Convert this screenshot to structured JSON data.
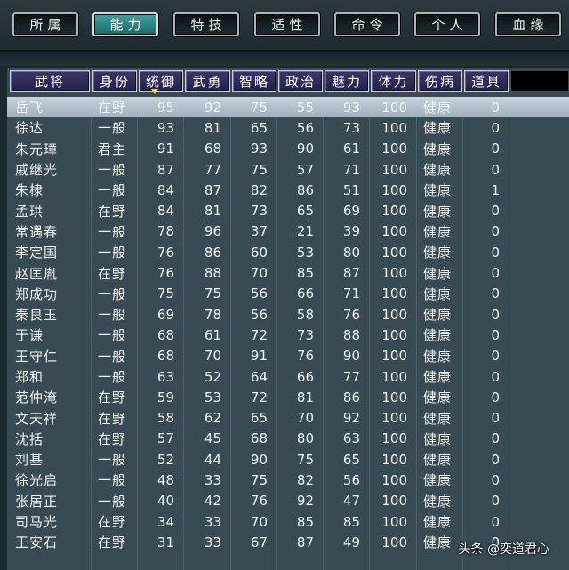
{
  "tabs": [
    {
      "label": "所属",
      "active": false
    },
    {
      "label": "能力",
      "active": true
    },
    {
      "label": "特技",
      "active": false
    },
    {
      "label": "适性",
      "active": false
    },
    {
      "label": "命令",
      "active": false
    },
    {
      "label": "个人",
      "active": false
    },
    {
      "label": "血缘",
      "active": false
    }
  ],
  "columns": [
    "武将",
    "身份",
    "统御",
    "武勇",
    "智略",
    "政治",
    "魅力",
    "体力",
    "伤病",
    "道具"
  ],
  "sorted_column": "统御",
  "rows": [
    [
      "岳飞",
      "在野",
      "95",
      "92",
      "75",
      "55",
      "93",
      "100",
      "健康",
      "0"
    ],
    [
      "徐达",
      "一般",
      "93",
      "81",
      "65",
      "56",
      "73",
      "100",
      "健康",
      "0"
    ],
    [
      "朱元璋",
      "君主",
      "91",
      "68",
      "93",
      "90",
      "61",
      "100",
      "健康",
      "0"
    ],
    [
      "戚继光",
      "一般",
      "87",
      "77",
      "75",
      "57",
      "71",
      "100",
      "健康",
      "0"
    ],
    [
      "朱棣",
      "一般",
      "84",
      "87",
      "82",
      "86",
      "51",
      "100",
      "健康",
      "1"
    ],
    [
      "孟珙",
      "在野",
      "84",
      "81",
      "73",
      "65",
      "69",
      "100",
      "健康",
      "0"
    ],
    [
      "常遇春",
      "一般",
      "78",
      "96",
      "37",
      "21",
      "39",
      "100",
      "健康",
      "0"
    ],
    [
      "李定国",
      "一般",
      "76",
      "86",
      "60",
      "53",
      "80",
      "100",
      "健康",
      "0"
    ],
    [
      "赵匡胤",
      "在野",
      "76",
      "88",
      "70",
      "85",
      "87",
      "100",
      "健康",
      "0"
    ],
    [
      "郑成功",
      "一般",
      "75",
      "75",
      "56",
      "66",
      "71",
      "100",
      "健康",
      "0"
    ],
    [
      "秦良玉",
      "一般",
      "69",
      "78",
      "56",
      "58",
      "76",
      "100",
      "健康",
      "0"
    ],
    [
      "于谦",
      "一般",
      "68",
      "61",
      "72",
      "73",
      "88",
      "100",
      "健康",
      "0"
    ],
    [
      "王守仁",
      "一般",
      "68",
      "70",
      "91",
      "76",
      "90",
      "100",
      "健康",
      "0"
    ],
    [
      "郑和",
      "一般",
      "63",
      "52",
      "64",
      "66",
      "77",
      "100",
      "健康",
      "0"
    ],
    [
      "范仲淹",
      "在野",
      "59",
      "53",
      "72",
      "81",
      "86",
      "100",
      "健康",
      "0"
    ],
    [
      "文天祥",
      "在野",
      "58",
      "62",
      "65",
      "70",
      "92",
      "100",
      "健康",
      "0"
    ],
    [
      "沈括",
      "在野",
      "57",
      "45",
      "68",
      "80",
      "63",
      "100",
      "健康",
      "0"
    ],
    [
      "刘基",
      "一般",
      "52",
      "44",
      "90",
      "75",
      "65",
      "100",
      "健康",
      "0"
    ],
    [
      "徐光启",
      "一般",
      "48",
      "33",
      "75",
      "82",
      "56",
      "100",
      "健康",
      "0"
    ],
    [
      "张居正",
      "一般",
      "40",
      "42",
      "76",
      "92",
      "47",
      "100",
      "健康",
      "0"
    ],
    [
      "司马光",
      "在野",
      "34",
      "33",
      "70",
      "85",
      "85",
      "100",
      "健康",
      "0"
    ],
    [
      "王安石",
      "在野",
      "31",
      "33",
      "67",
      "87",
      "49",
      "100",
      "健康",
      "0"
    ]
  ],
  "selected_row": 0,
  "watermark": "头条 @奕道君心",
  "colors": {
    "tab_active": "#2a8a8a",
    "header_bg": "#2d2b5c",
    "selected_row": "#b8c6d2",
    "grid_bg": "#384a54"
  }
}
